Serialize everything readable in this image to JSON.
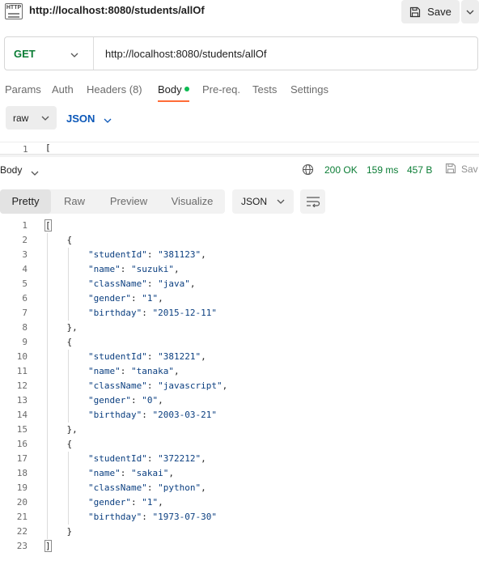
{
  "request": {
    "icon_text": "HTTP",
    "title": "http://localhost:8080/students/allOf",
    "save_label": "Save"
  },
  "url_bar": {
    "method": "GET",
    "url": "http://localhost:8080/students/allOf"
  },
  "request_tabs": [
    {
      "label": "Params",
      "active": false
    },
    {
      "label": "Auth",
      "active": false
    },
    {
      "label": "Headers (8)",
      "active": false
    },
    {
      "label": "Body",
      "active": true
    },
    {
      "label": "Pre-req.",
      "active": false
    },
    {
      "label": "Tests",
      "active": false
    },
    {
      "label": "Settings",
      "active": false
    }
  ],
  "body_options": {
    "mode": "raw",
    "language": "JSON"
  },
  "editor": {
    "line_number": "1",
    "first_char": "["
  },
  "response": {
    "section_label": "Body",
    "status": "200 OK",
    "time": "159 ms",
    "size": "457 B",
    "save_label": "Sav",
    "view_tabs": [
      "Pretty",
      "Raw",
      "Preview",
      "Visualize"
    ],
    "active_view": "Pretty",
    "format": "JSON",
    "lines": [
      "[",
      "    {",
      "        \"studentId\": \"381123\",",
      "        \"name\": \"suzuki\",",
      "        \"className\": \"java\",",
      "        \"gender\": \"1\",",
      "        \"birthday\": \"2015-12-11\"",
      "    },",
      "    {",
      "        \"studentId\": \"381221\",",
      "        \"name\": \"tanaka\",",
      "        \"className\": \"javascript\",",
      "        \"gender\": \"0\",",
      "        \"birthday\": \"2003-03-21\"",
      "    },",
      "    {",
      "        \"studentId\": \"372212\",",
      "        \"name\": \"sakai\",",
      "        \"className\": \"python\",",
      "        \"gender\": \"1\",",
      "        \"birthday\": \"1973-07-30\"",
      "    }",
      "]"
    ]
  },
  "colors": {
    "accent": "#ff6c37",
    "method_get": "#0b7d35",
    "status_ok": "#0b7d35",
    "link": "#0b57b8"
  }
}
